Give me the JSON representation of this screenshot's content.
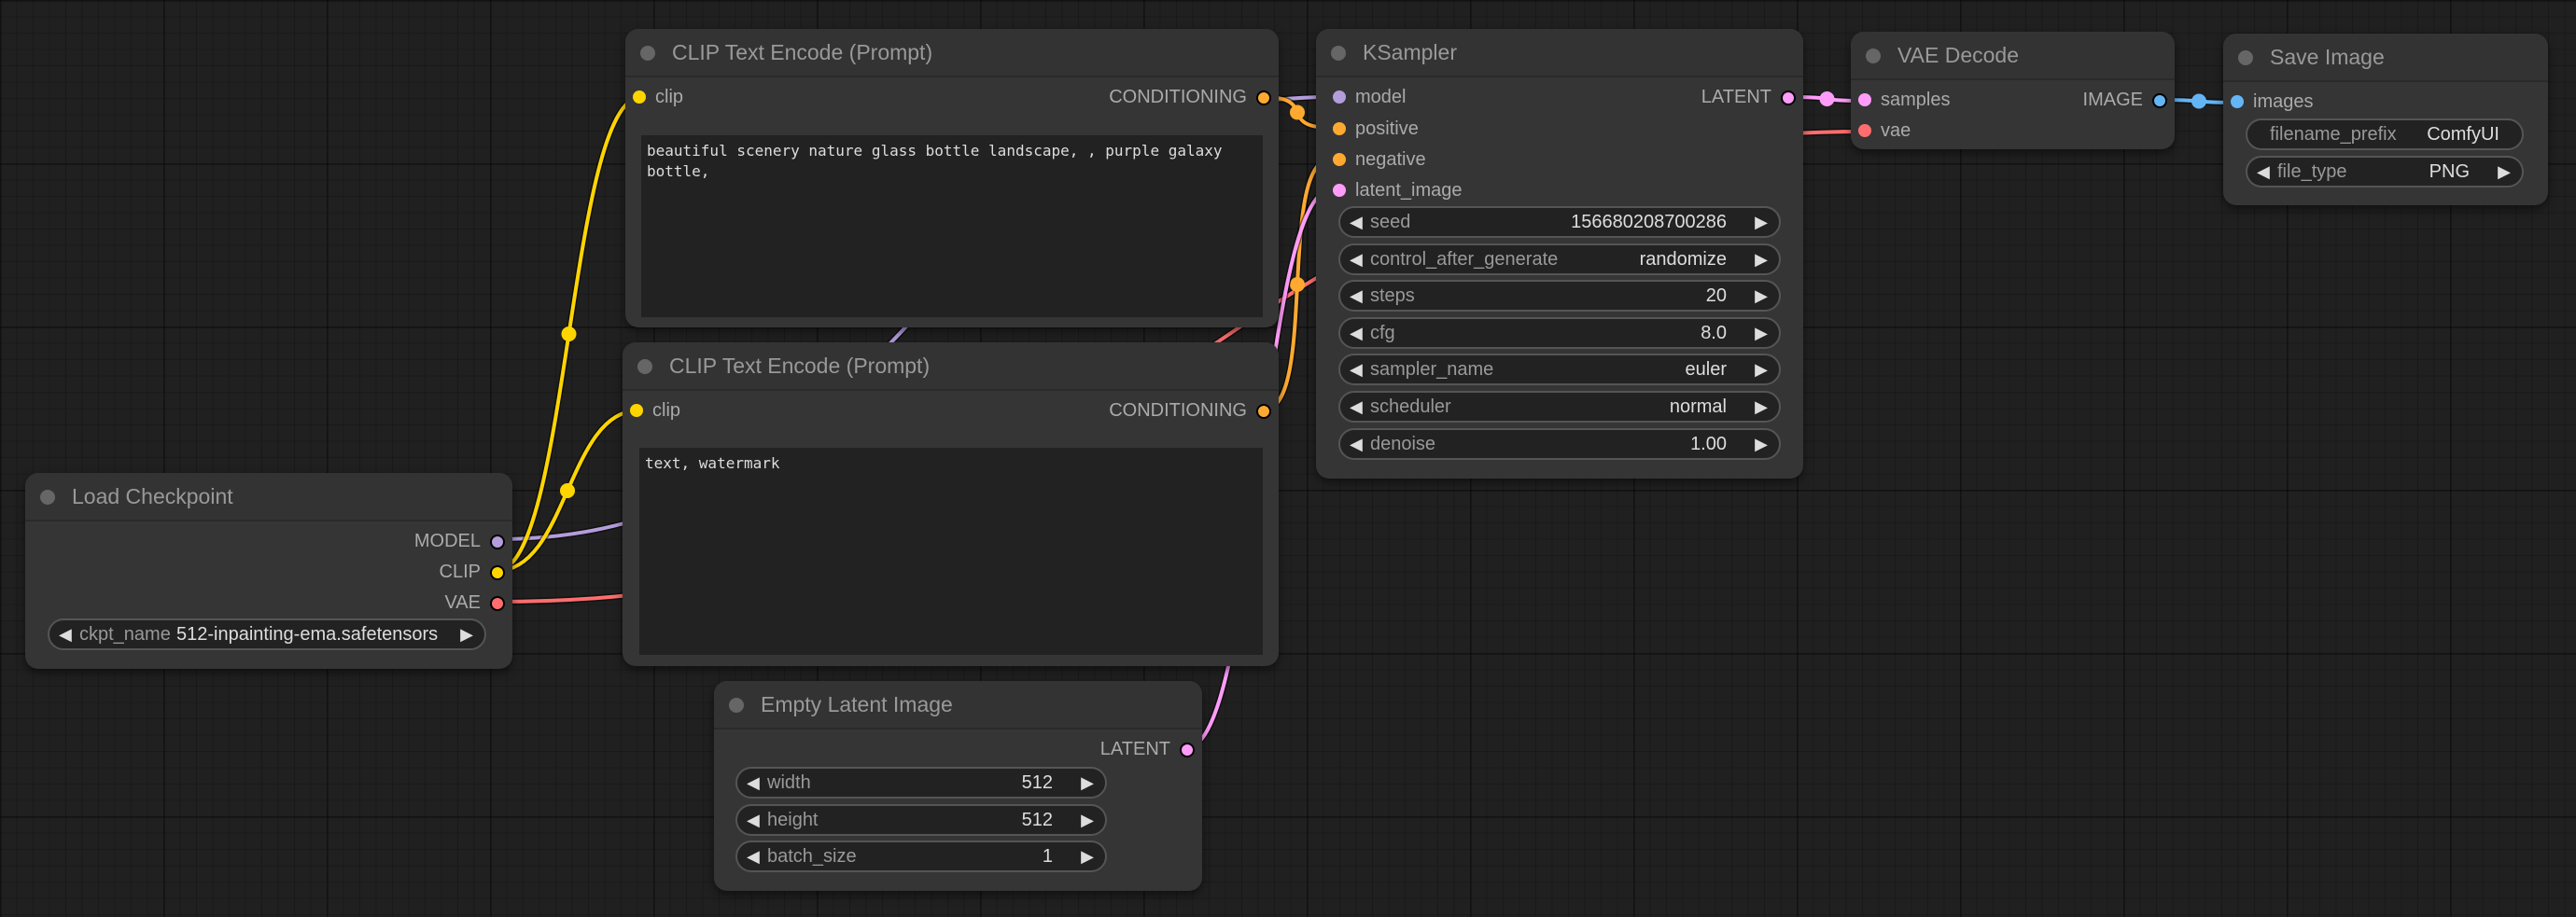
{
  "colors": {
    "model": "#b39ddb",
    "clip": "#ffd500",
    "vae": "#ff6e6e",
    "conditioning": "#ffa931",
    "latent": "#ff9cf9",
    "image": "#64b5f6"
  },
  "nodes": {
    "load_checkpoint": {
      "title": "Load Checkpoint",
      "outputs": [
        "MODEL",
        "CLIP",
        "VAE"
      ],
      "ckpt_label": "ckpt_name",
      "ckpt_value": "512-inpainting-ema.safetensors"
    },
    "clip_pos": {
      "title": "CLIP Text Encode (Prompt)",
      "input": "clip",
      "output": "CONDITIONING",
      "text": "beautiful scenery nature glass bottle landscape, , purple galaxy bottle,"
    },
    "clip_neg": {
      "title": "CLIP Text Encode (Prompt)",
      "input": "clip",
      "output": "CONDITIONING",
      "text": "text, watermark"
    },
    "empty_latent": {
      "title": "Empty Latent Image",
      "output": "LATENT",
      "widgets": [
        {
          "label": "width",
          "value": "512"
        },
        {
          "label": "height",
          "value": "512"
        },
        {
          "label": "batch_size",
          "value": "1"
        }
      ]
    },
    "ksampler": {
      "title": "KSampler",
      "inputs": [
        "model",
        "positive",
        "negative",
        "latent_image"
      ],
      "output": "LATENT",
      "widgets": [
        {
          "label": "seed",
          "value": "156680208700286"
        },
        {
          "label": "control_after_generate",
          "value": "randomize"
        },
        {
          "label": "steps",
          "value": "20"
        },
        {
          "label": "cfg",
          "value": "8.0"
        },
        {
          "label": "sampler_name",
          "value": "euler"
        },
        {
          "label": "scheduler",
          "value": "normal"
        },
        {
          "label": "denoise",
          "value": "1.00"
        }
      ]
    },
    "vae_decode": {
      "title": "VAE Decode",
      "inputs": [
        "samples",
        "vae"
      ],
      "output": "IMAGE"
    },
    "save_image": {
      "title": "Save Image",
      "input": "images",
      "prefix_label": "filename_prefix",
      "prefix_value": "ComfyUI",
      "filetype_label": "file_type",
      "filetype_value": "PNG"
    }
  },
  "icons": {
    "left_arrow": "◀",
    "right_arrow": "▶"
  }
}
